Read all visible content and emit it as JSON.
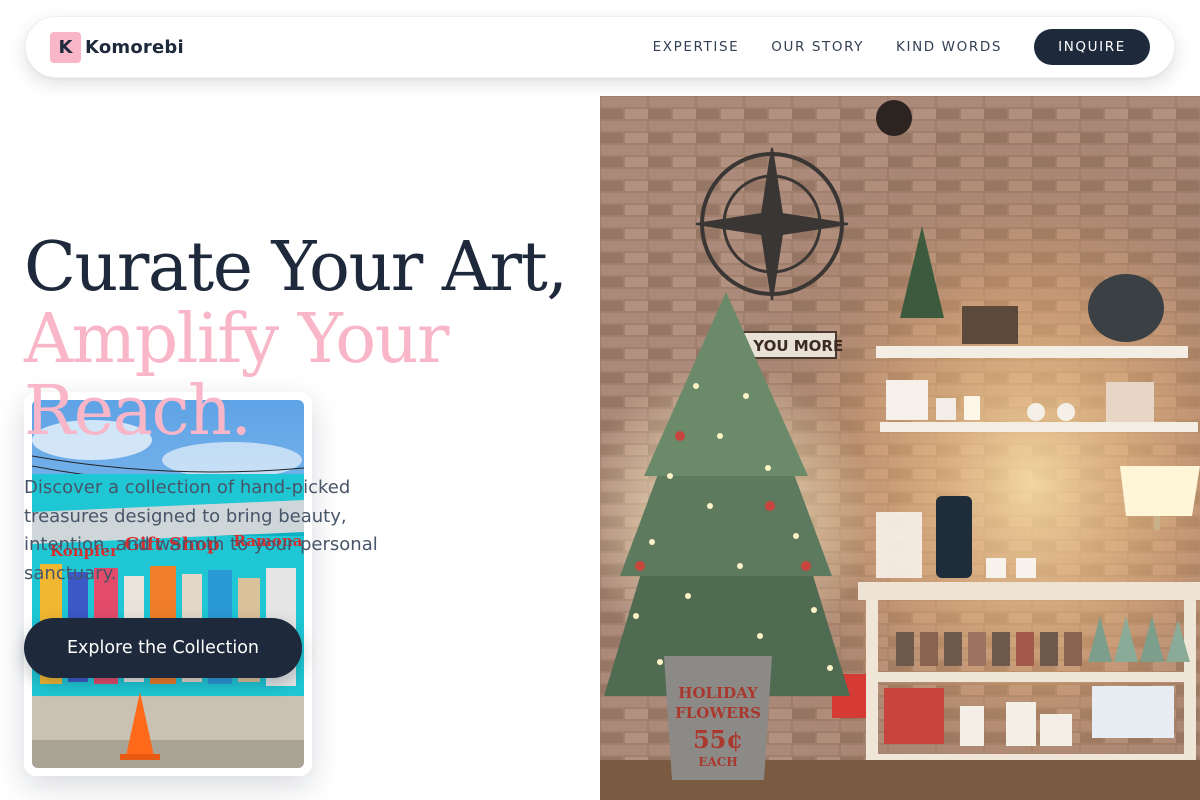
{
  "brand": {
    "mark": "K",
    "name": "Komorebi",
    "color": "#f9b6c8"
  },
  "nav": {
    "links": [
      "EXPERTISE",
      "OUR STORY",
      "KIND WORDS"
    ],
    "cta": "INQUIRE"
  },
  "hero": {
    "headline_line1": "Curate Your Art,",
    "headline_line2": "Amplify Your Reach.",
    "subtext": "Discover a collection of hand-picked treasures designed to bring beauty, intention, and warmth to your personal sanctuary.",
    "cta": "Explore the Collection"
  },
  "images": {
    "inset": {
      "sign_left": "Konpfer",
      "sign_center": "Gift Shop",
      "sign_right": "Ramona"
    },
    "main": {
      "sign_text": "LOVE YOU MORE",
      "bucket_line1": "HOLIDAY",
      "bucket_line2": "FLOWERS",
      "bucket_price": "55¢",
      "bucket_each": "EACH"
    }
  },
  "colors": {
    "dark": "#1e293b",
    "accent": "#f9b6c8",
    "muted_text": "#475569"
  }
}
